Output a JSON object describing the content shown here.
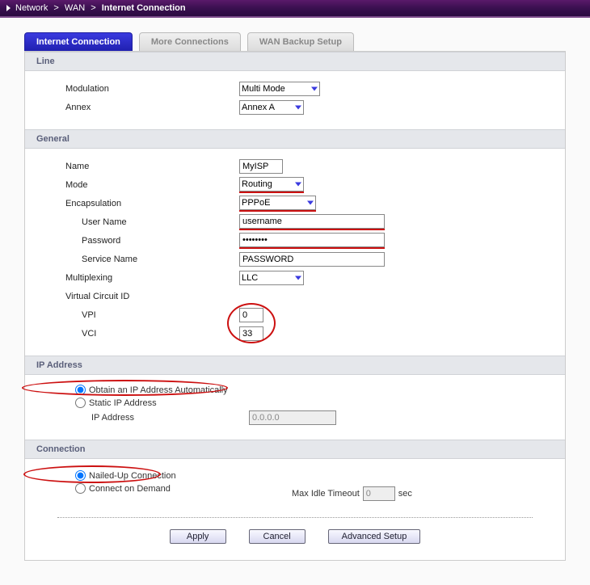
{
  "titlebar": {
    "seg1": "Network",
    "seg2": "WAN",
    "seg3": "Internet Connection"
  },
  "tabs": {
    "t1": "Internet Connection",
    "t2": "More Connections",
    "t3": "WAN Backup Setup"
  },
  "sections": {
    "line": "Line",
    "general": "General",
    "ipaddress": "IP Address",
    "connection": "Connection"
  },
  "line": {
    "modulation_label": "Modulation",
    "modulation_value": "Multi Mode",
    "annex_label": "Annex",
    "annex_value": "Annex A"
  },
  "general": {
    "name_label": "Name",
    "name_value": "MyISP",
    "mode_label": "Mode",
    "mode_value": "Routing",
    "encapsulation_label": "Encapsulation",
    "encapsulation_value": "PPPoE",
    "username_label": "User Name",
    "username_value": "username",
    "password_label": "Password",
    "password_value": "••••••••",
    "servicename_label": "Service Name",
    "servicename_value": "PASSWORD",
    "multiplexing_label": "Multiplexing",
    "multiplexing_value": "LLC",
    "vcid_label": "Virtual Circuit ID",
    "vpi_label": "VPI",
    "vpi_value": "0",
    "vci_label": "VCI",
    "vci_value": "33"
  },
  "ipaddress": {
    "obtain": "Obtain an IP Address Automatically",
    "static": "Static IP Address",
    "ipaddr_label": "IP Address",
    "ipaddr_value": "0.0.0.0"
  },
  "connection": {
    "nailed": "Nailed-Up Connection",
    "ondemand": "Connect on Demand",
    "maxidle_label": "Max Idle Timeout",
    "maxidle_value": "0",
    "sec": "sec"
  },
  "buttons": {
    "apply": "Apply",
    "cancel": "Cancel",
    "advanced": "Advanced Setup"
  }
}
